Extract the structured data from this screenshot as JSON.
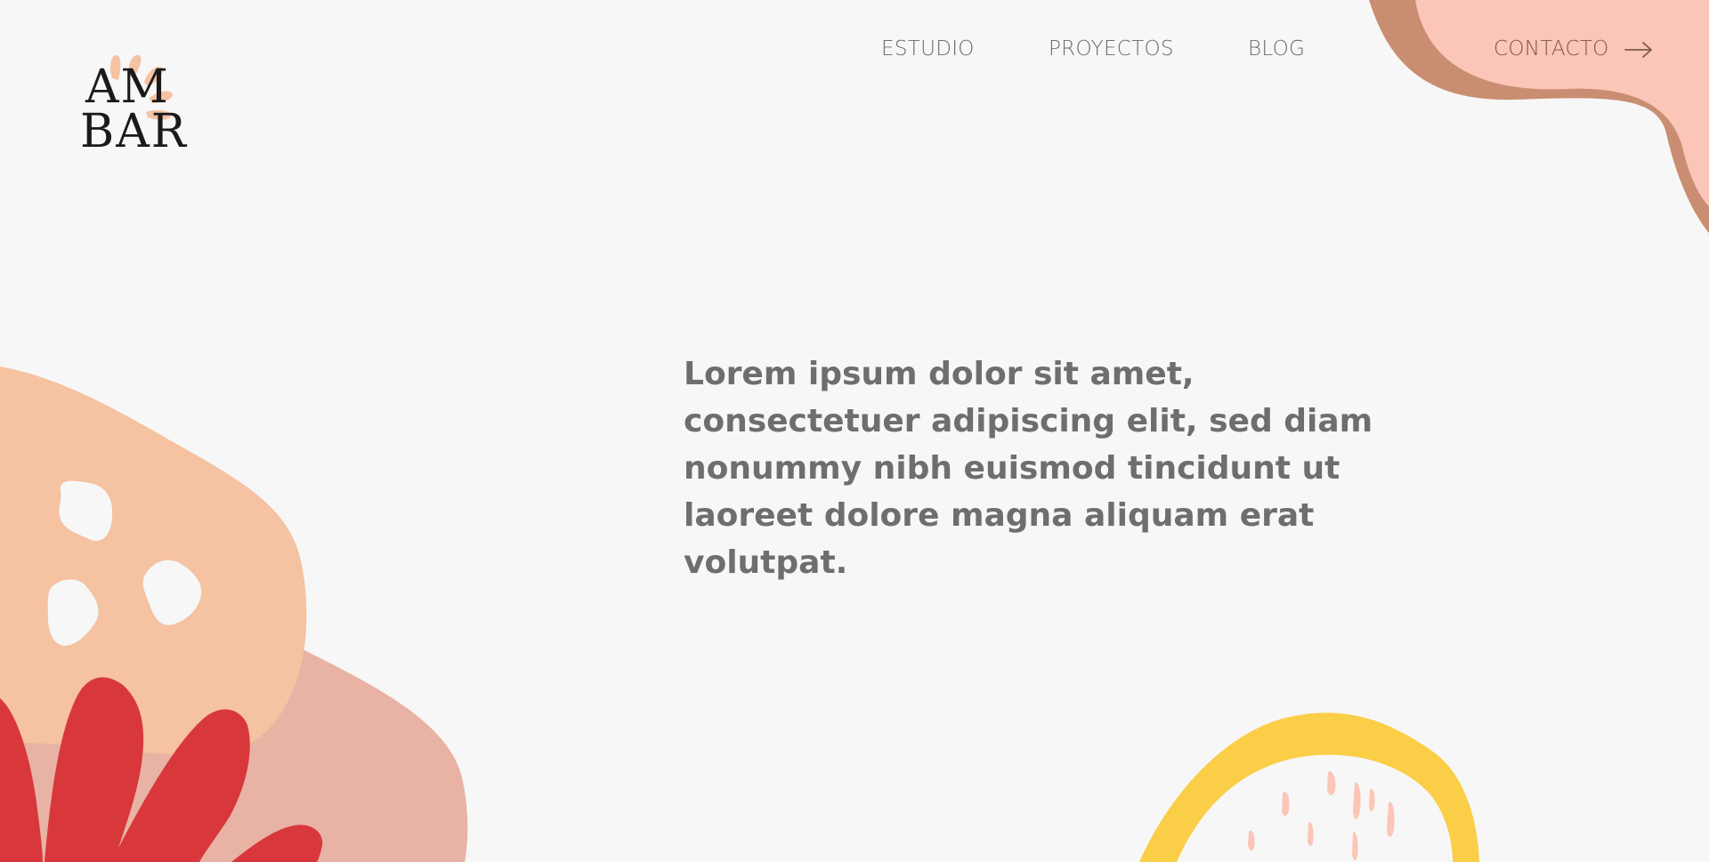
{
  "brand": {
    "logo_line_1": "AM",
    "logo_line_2": "BAR"
  },
  "nav": {
    "items": [
      {
        "label": "ESTUDIO"
      },
      {
        "label": "PROYECTOS"
      },
      {
        "label": "BLOG"
      }
    ],
    "cta_label": "CONTACTO",
    "cta_icon": "arrow-right-icon"
  },
  "hero": {
    "text": "Lorem ipsum dolor sit amet, consectetuer adipiscing elit, sed diam nonummy nibh euismod tincidunt ut laoreet dolore magna aliquam erat volutpat."
  },
  "colors": {
    "background": "#f7f7f7",
    "peach": "#f5c2a2",
    "dusty_pink": "#e8b2a4",
    "red": "#d8383b",
    "yellow": "#fbce48",
    "blush": "#fbc5b7",
    "brown": "#c98e72",
    "text_gray": "#6e6e6e"
  }
}
